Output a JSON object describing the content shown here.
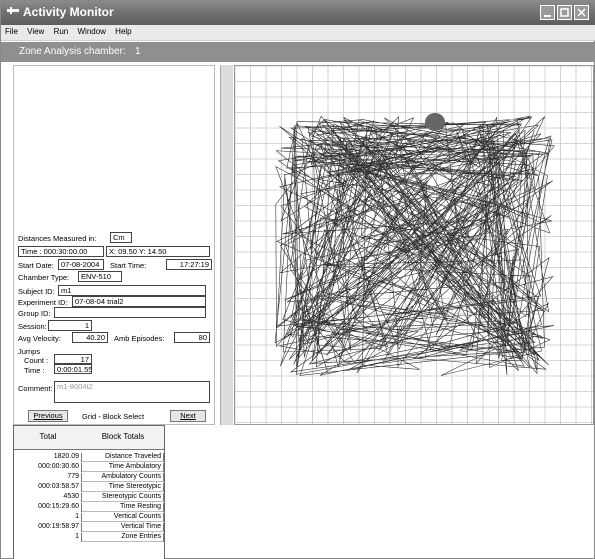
{
  "window": {
    "title": "Activity Monitor",
    "menu": [
      "File",
      "View",
      "Run",
      "Window",
      "Help"
    ]
  },
  "zone": {
    "label": "Zone Analysis chamber:",
    "value": "1"
  },
  "form": {
    "distances_label": "Distances Measured  in:",
    "distances_unit": "Cm",
    "time_field": "Time : 000:30:00.00",
    "xy_field": "X: 09.50 Y: 14.50",
    "start_date_label": "Start Date:",
    "start_date": "07-08-2004",
    "start_time_label": "Start Time:",
    "start_time": "17:27:19",
    "chamber_type_label": "Chamber Type:",
    "chamber_type": "ENV-510",
    "subject_label": "Subject ID:",
    "subject": "m1",
    "experiment_label": "Experiment ID:",
    "experiment": "07-08-04 trial2",
    "group_label": "Group ID:",
    "group": "",
    "session_label": "Session:",
    "session": "1",
    "avg_velocity_label": "Avg Velocity:",
    "avg_velocity": "40.20",
    "amb_episodes_label": "Amb Episodes:",
    "amb_episodes": "80",
    "jumps_label": "Jumps",
    "count_label": "Count :",
    "count": "17",
    "time_label": "Time :",
    "time": "0:00:01.55",
    "comment_label": "Comment:",
    "comment": "m1-8004t2"
  },
  "nav": {
    "previous": "Previous",
    "mode": "Grid - Block Select",
    "next": "Next"
  },
  "table": {
    "headers": [
      "Total",
      "Block Totals"
    ],
    "rows": [
      [
        "1820.09",
        "Distance Traveled"
      ],
      [
        "000:00:30.60",
        "Time Ambulatory"
      ],
      [
        "779",
        "Ambulatory Counts"
      ],
      [
        "000:03:58.57",
        "Time Stereotypic"
      ],
      [
        "4530",
        "Stereotypic Counts"
      ],
      [
        "000:15:29.60",
        "Time Resting"
      ],
      [
        "1",
        "Vertical Counts"
      ],
      [
        "000:19:58.97",
        "Vertical Time"
      ],
      [
        "1",
        "Zone Entries"
      ]
    ]
  },
  "colors": {
    "title_bar": "#6c6c6c",
    "zone_bar": "#8f8f8f",
    "grid_line": "#c8c8c8",
    "marker": "#666666"
  }
}
